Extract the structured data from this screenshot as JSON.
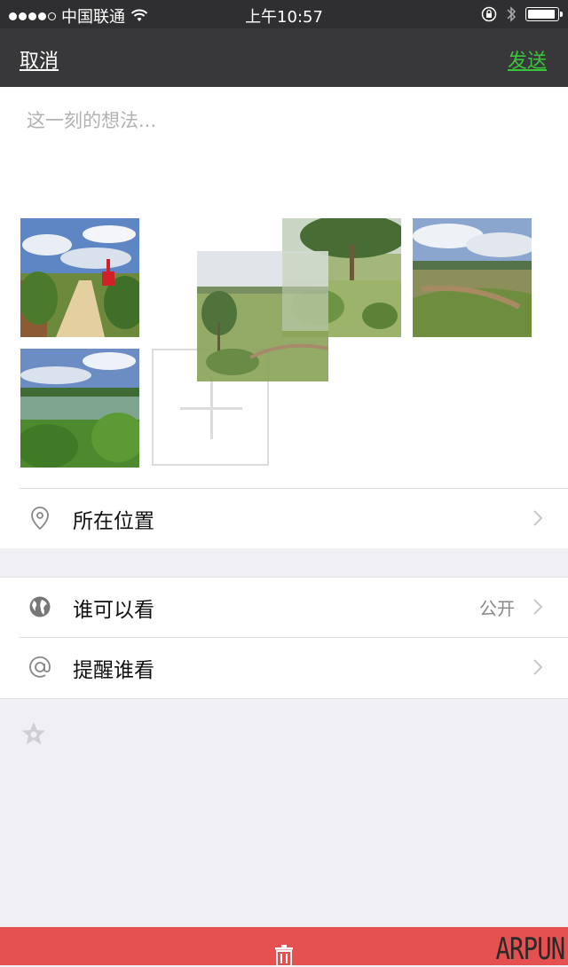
{
  "status_bar": {
    "carrier": "中国联通",
    "time": "上午10:57",
    "battery_level": 0.95
  },
  "nav": {
    "cancel_label": "取消",
    "send_label": "发送"
  },
  "compose": {
    "placeholder": "这一刻的想法..."
  },
  "options": {
    "location_label": "所在位置",
    "visibility_label": "谁可以看",
    "visibility_value": "公开",
    "mention_label": "提醒谁看"
  },
  "watermark": "ARPUN",
  "colors": {
    "send": "#3ac53a",
    "bottom_bar": "#e55050",
    "nav_bg": "#38383a"
  },
  "icons": [
    "wifi-icon",
    "lock-rotation-icon",
    "bluetooth-icon",
    "battery-icon",
    "location-pin-icon",
    "globe-icon",
    "at-icon",
    "chevron-right-icon",
    "star-icon",
    "trash-icon"
  ]
}
